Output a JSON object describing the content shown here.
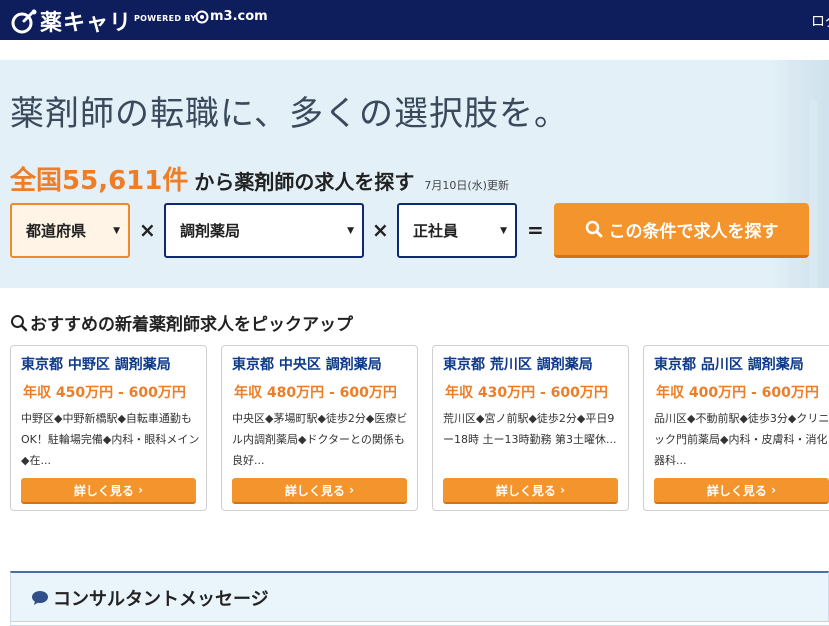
{
  "header": {
    "logo_text": "薬キャリ",
    "powered_by": "POWERED BY",
    "partner": "m3.com",
    "login": "ログ"
  },
  "hero": {
    "catch_copy": "薬剤師の転職に、多くの選択肢を。",
    "count_prefix": "全国",
    "count_number": "55,611",
    "count_suffix": "件",
    "count_rest": "から薬剤師の求人を探す",
    "updated": "7月10日(水)更新",
    "select_prefecture": "都道府県",
    "select_type": "調剤薬局",
    "select_employment": "正社員",
    "op_times": "×",
    "op_equals": "=",
    "search_button": "この条件で求人を探す"
  },
  "pickup": {
    "title": "おすすめの新着薬剤師求人をピックアップ",
    "cards": [
      {
        "title": "東京都 中野区 調剤薬局",
        "salary": "年収 450万円 - 600万円",
        "desc": "中野区◆中野新橋駅◆自転車通勤もOK！駐輪場完備◆内科・眼科メイン◆在...",
        "button": "詳しく見る"
      },
      {
        "title": "東京都 中央区 調剤薬局",
        "salary": "年収 480万円 - 600万円",
        "desc": "中央区◆茅場町駅◆徒歩2分◆医療ビル内調剤薬局◆ドクターとの関係も良好...",
        "button": "詳しく見る"
      },
      {
        "title": "東京都 荒川区 調剤薬局",
        "salary": "年収 430万円 - 600万円",
        "desc": "荒川区◆宮ノ前駅◆徒歩2分◆平日9ー18時 土ー13時勤務 第3土曜休...",
        "button": "詳しく見る"
      },
      {
        "title": "東京都 品川区 調剤薬局",
        "salary": "年収 400万円 - 600万円",
        "desc": "品川区◆不動前駅◆徒歩3分◆クリニック門前薬局◆内科・皮膚科・消化器科...",
        "button": "詳しく見る"
      }
    ]
  },
  "consult": {
    "title": "コンサルタントメッセージ"
  },
  "colors": {
    "header_bg": "#0e1e5c",
    "accent_orange": "#f4942c",
    "hero_bg": "#e3f0f8",
    "link_blue": "#0e3a8a"
  }
}
